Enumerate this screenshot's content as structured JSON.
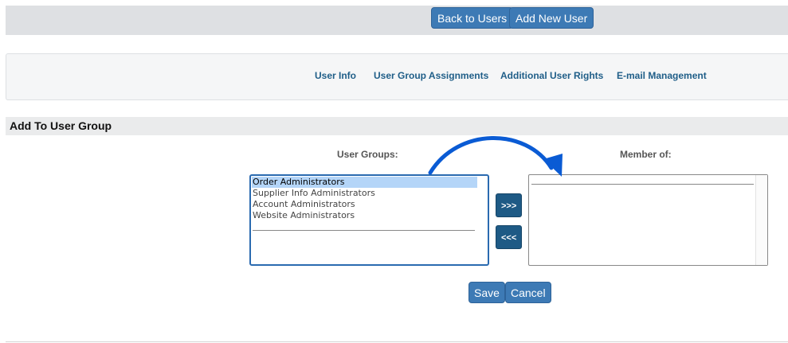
{
  "toolbar": {
    "back_label": "Back to Users",
    "add_label": "Add New User"
  },
  "tabs": [
    {
      "label": "User Info"
    },
    {
      "label": "User Group Assignments"
    },
    {
      "label": "Additional User Rights"
    },
    {
      "label": "E-mail Management"
    }
  ],
  "section": {
    "title": "Add To User Group"
  },
  "user_groups": {
    "label": "User Groups:",
    "options": [
      {
        "label": "Order Administrators",
        "selected": true
      },
      {
        "label": "Supplier Info Administrators"
      },
      {
        "label": "Account Administrators"
      },
      {
        "label": "Website Administrators"
      }
    ]
  },
  "member_of": {
    "label": "Member of:",
    "options": []
  },
  "move": {
    "add_label": ">>>",
    "remove_label": "<<<"
  },
  "form": {
    "save_label": "Save",
    "cancel_label": "Cancel"
  },
  "colors": {
    "button": "#3d7ab5",
    "move_button": "#1e5a85",
    "link": "#1f5e88",
    "annotation_arrow": "#0a5bd4",
    "selection": "#b4d5f8"
  },
  "icons": {
    "annotation": "curved-arrow-icon"
  }
}
